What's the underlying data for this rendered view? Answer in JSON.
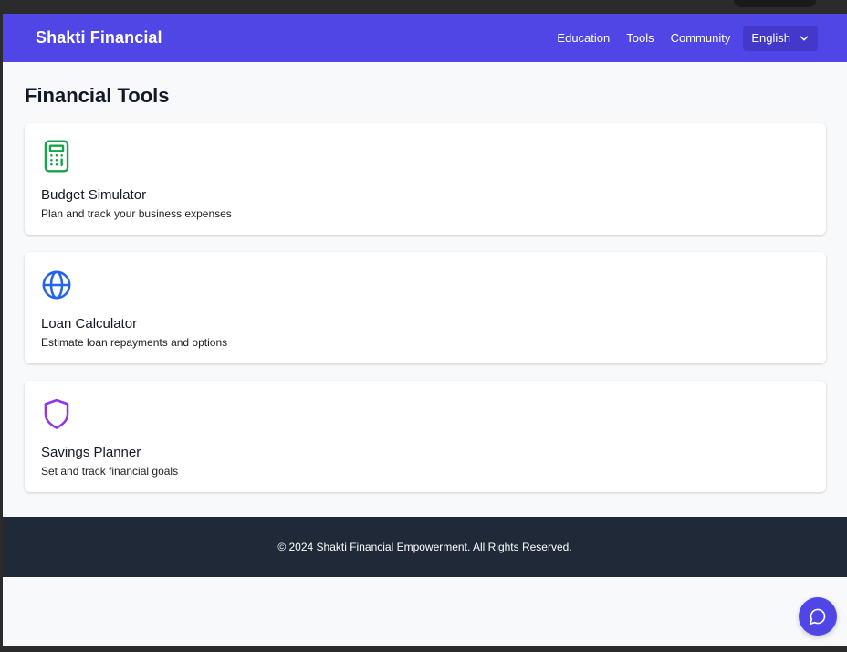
{
  "colors": {
    "brand": "#4f46e5",
    "footer": "#1f2937",
    "budget_icon": "#16a34a",
    "loan_icon": "#2563eb",
    "savings_icon": "#9333ea"
  },
  "header": {
    "brand": "Shakti Financial",
    "nav": [
      "Education",
      "Tools",
      "Community"
    ],
    "language": "English",
    "language_icon": "chevron-down-icon"
  },
  "main": {
    "title": "Financial Tools",
    "tools": [
      {
        "icon": "calculator-icon",
        "title": "Budget Simulator",
        "description": "Plan and track your business expenses"
      },
      {
        "icon": "globe-icon",
        "title": "Loan Calculator",
        "description": "Estimate loan repayments and options"
      },
      {
        "icon": "shield-icon",
        "title": "Savings Planner",
        "description": "Set and track financial goals"
      }
    ]
  },
  "footer": {
    "copyright": "© 2024 Shakti Financial Empowerment. All Rights Reserved."
  },
  "chat": {
    "icon": "chat-bubble-icon"
  }
}
